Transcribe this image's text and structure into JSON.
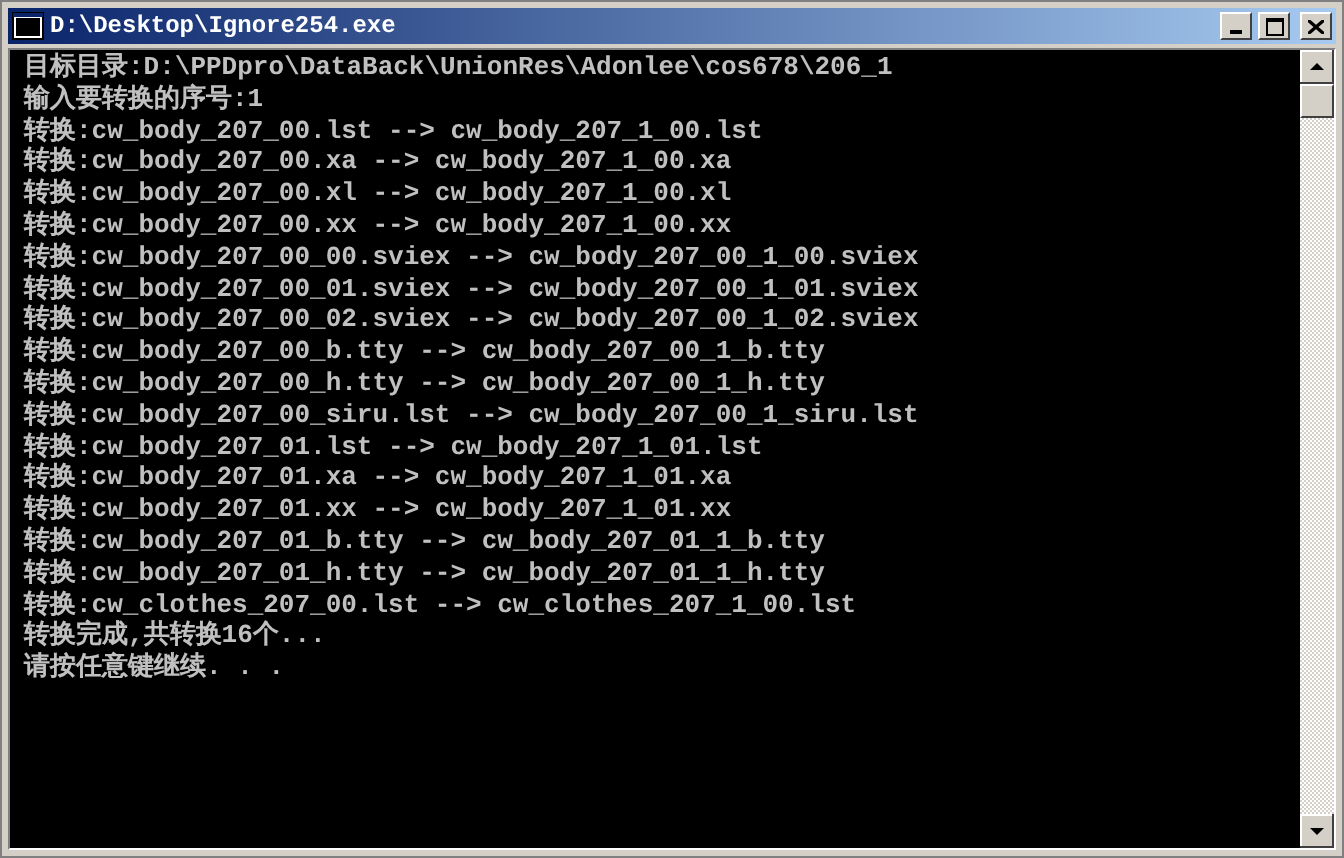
{
  "window": {
    "title": "D:\\Desktop\\Ignore254.exe"
  },
  "console": {
    "lines": [
      "目标目录:D:\\PPDpro\\DataBack\\UnionRes\\Adonlee\\cos678\\206_1",
      "输入要转换的序号:1",
      "转换:cw_body_207_00.lst --> cw_body_207_1_00.lst",
      "转换:cw_body_207_00.xa --> cw_body_207_1_00.xa",
      "转换:cw_body_207_00.xl --> cw_body_207_1_00.xl",
      "转换:cw_body_207_00.xx --> cw_body_207_1_00.xx",
      "转换:cw_body_207_00_00.sviex --> cw_body_207_00_1_00.sviex",
      "转换:cw_body_207_00_01.sviex --> cw_body_207_00_1_01.sviex",
      "转换:cw_body_207_00_02.sviex --> cw_body_207_00_1_02.sviex",
      "转换:cw_body_207_00_b.tty --> cw_body_207_00_1_b.tty",
      "转换:cw_body_207_00_h.tty --> cw_body_207_00_1_h.tty",
      "转换:cw_body_207_00_siru.lst --> cw_body_207_00_1_siru.lst",
      "转换:cw_body_207_01.lst --> cw_body_207_1_01.lst",
      "转换:cw_body_207_01.xa --> cw_body_207_1_01.xa",
      "转换:cw_body_207_01.xx --> cw_body_207_1_01.xx",
      "转换:cw_body_207_01_b.tty --> cw_body_207_01_1_b.tty",
      "转换:cw_body_207_01_h.tty --> cw_body_207_01_1_h.tty",
      "转换:cw_clothes_207_00.lst --> cw_clothes_207_1_00.lst",
      "转换完成,共转换16个...",
      "请按任意键继续. . ."
    ]
  }
}
